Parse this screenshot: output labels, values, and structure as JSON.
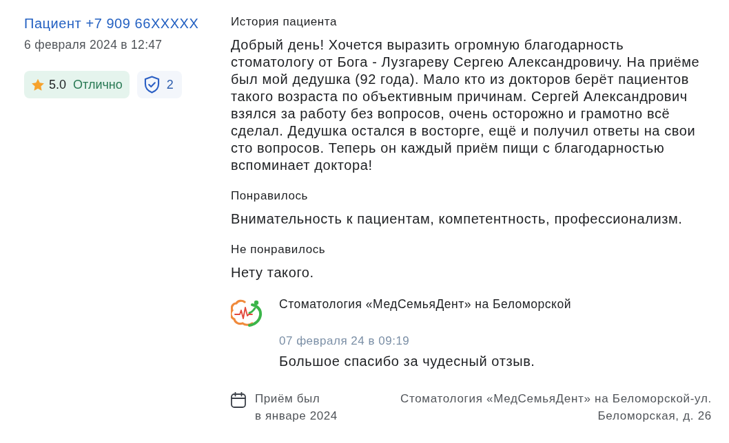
{
  "review": {
    "author": "Пациент +7 909 66XXXXX",
    "date": "6 февраля 2024 в 12:47",
    "rating": {
      "value": "5.0",
      "label": "Отлично"
    },
    "verification": {
      "count": "2"
    },
    "sections": [
      {
        "heading": "История пациента",
        "text": "Добрый день! Хочется выразить огромную благодарность стоматологу от Бога - Лузгареву Сергею Александровичу. На приёме был мой дедушка (92 года). Мало кто из докторов берёт пациентов такого возраста по объективным причинам. Сергей Александрович взялся за работу без вопросов, очень осторожно и грамотно всё сделал. Дедушка остался в восторге, ещё и получил ответы на свои сто вопросов. Теперь он каждый приём пищи с благодарностью вспоминает доктора!"
      },
      {
        "heading": "Понравилось",
        "text": "Внимательность к пациентам, компетентность, профессионализм."
      },
      {
        "heading": "Не понравилось",
        "text": "Нету такого."
      }
    ],
    "reply": {
      "clinic": "Стоматология «МедСемьяДент» на Беломорской",
      "date": "07 февраля 24 в 09:19",
      "text": "Большое спасибо за чудесный отзыв."
    },
    "visit": {
      "label": "Приём был",
      "period": "в январе 2024"
    },
    "address": "Стоматология «МедСемьяДент» на Беломорской-ул. Беломорская, д. 26"
  }
}
